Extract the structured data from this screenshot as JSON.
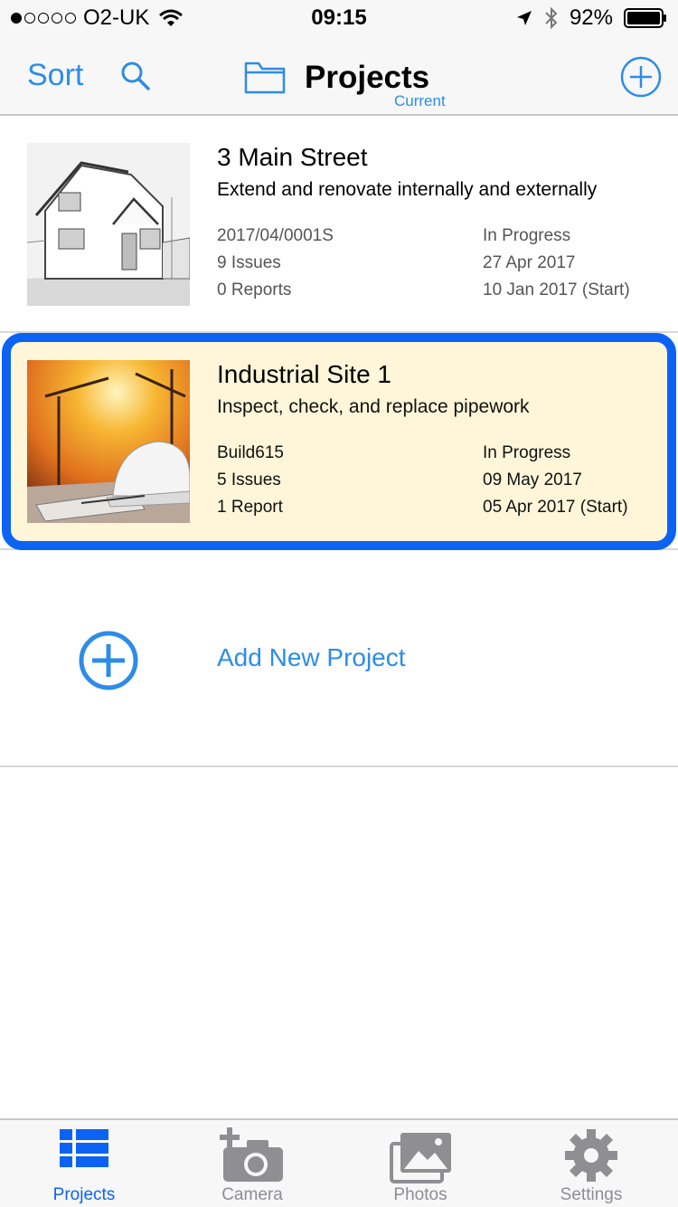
{
  "status_bar": {
    "carrier": "O2-UK",
    "time": "09:15",
    "battery": "92%"
  },
  "nav": {
    "sort_label": "Sort",
    "title": "Projects",
    "subtitle": "Current"
  },
  "projects": [
    {
      "title": "3 Main Street",
      "description": "Extend and renovate internally and externally",
      "ref": "2017/04/0001S",
      "issues": "9 Issues",
      "reports": "0 Reports",
      "status": "In Progress",
      "date": "27 Apr 2017",
      "start": "10 Jan 2017 (Start)"
    },
    {
      "title": "Industrial Site 1",
      "description": "Inspect, check, and replace pipework",
      "ref": "Build615",
      "issues": "5 Issues",
      "reports": "1 Report",
      "status": "In Progress",
      "date": "09 May 2017",
      "start": "05 Apr 2017 (Start)"
    }
  ],
  "add_project_label": "Add New Project",
  "tabs": [
    {
      "label": "Projects",
      "icon": "list-icon"
    },
    {
      "label": "Camera",
      "icon": "camera-add-icon"
    },
    {
      "label": "Photos",
      "icon": "photos-icon"
    },
    {
      "label": "Settings",
      "icon": "gear-icon"
    }
  ],
  "colors": {
    "accent": "#2d8ce8",
    "tab_active": "#0c63f3",
    "highlight_border": "#0c63f3",
    "highlight_bg": "#fff6d9"
  }
}
